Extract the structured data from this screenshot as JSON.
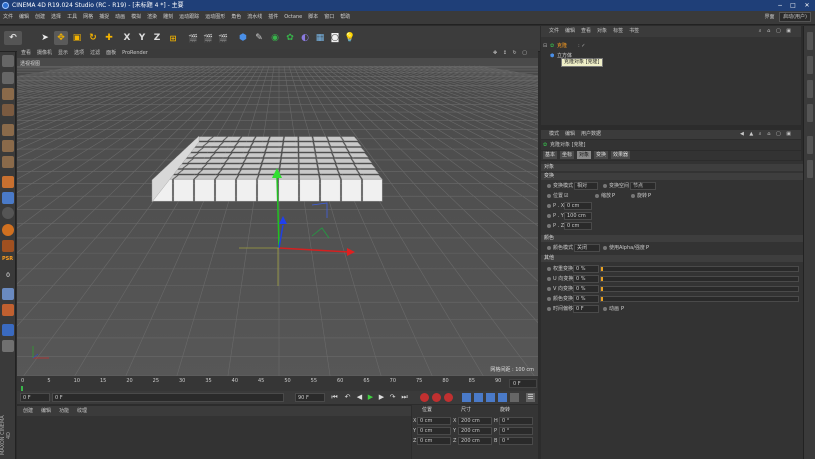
{
  "window": {
    "title": "CINEMA 4D R19.024 Studio (RC - R19) - [未标题 4 *] - 主要",
    "minimize": "−",
    "maximize": "□",
    "close": "✕"
  },
  "menubar": {
    "items": [
      "文件",
      "编辑",
      "创建",
      "选择",
      "工具",
      "网格",
      "捕捉",
      "动画",
      "模拟",
      "渲染",
      "雕刻",
      "运动跟踪",
      "运动图形",
      "角色",
      "流水线",
      "插件",
      "Octane",
      "脚本",
      "窗口",
      "帮助"
    ],
    "layout_label": "界面",
    "layout_value": "启动(用户)"
  },
  "toolbar": {
    "undo_icon": "undo-icon",
    "axis_x": "X",
    "axis_y": "Y",
    "axis_z": "Z"
  },
  "viewport": {
    "menu": [
      "查看",
      "摄像机",
      "显示",
      "选项",
      "过滤",
      "面板",
      "ProRender"
    ],
    "camera_label": "透视视图",
    "grid_distance": "网格间距 : 100 cm",
    "cubes": {
      "rows": 8,
      "cols": 11
    }
  },
  "timeline": {
    "ticks": [
      "0",
      "5",
      "10",
      "15",
      "20",
      "25",
      "30",
      "35",
      "40",
      "45",
      "50",
      "55",
      "60",
      "65",
      "70",
      "75",
      "80",
      "85",
      "90"
    ],
    "current_frame": "0 F"
  },
  "transport": {
    "start": "0 F",
    "current": "0 F",
    "end": "90 F",
    "max": "90 F"
  },
  "materials": {
    "menu": [
      "创建",
      "编辑",
      "功能",
      "纹理"
    ]
  },
  "coordinates": {
    "headers": [
      "位置",
      "尺寸",
      "旋转"
    ],
    "rows": [
      {
        "axis": "X",
        "pos": "0 cm",
        "size_axis": "X",
        "size": "200 cm",
        "rot_axis": "H",
        "rot": "0 °"
      },
      {
        "axis": "Y",
        "pos": "0 cm",
        "size_axis": "Y",
        "size": "200 cm",
        "rot_axis": "P",
        "rot": "0 °"
      },
      {
        "axis": "Z",
        "pos": "0 cm",
        "size_axis": "Z",
        "size": "200 cm",
        "rot_axis": "B",
        "rot": "0 °"
      }
    ]
  },
  "object_manager": {
    "tabs": [
      "文件",
      "编辑",
      "查看",
      "对象",
      "标签",
      "书签"
    ],
    "objects": [
      {
        "name": "克隆"
      },
      {
        "name": "立方体"
      }
    ],
    "tooltip": "克隆对象 [克隆]"
  },
  "attribute_manager": {
    "menu": [
      "模式",
      "编辑",
      "用户数据"
    ],
    "title": "克隆对象 [克隆]",
    "tabs": [
      "基本",
      "坐标",
      "对象",
      "变换",
      "效果器"
    ],
    "active_tab": "对象",
    "section_object": "对象",
    "section_transform": "变换",
    "section_color": "颜色",
    "section_other": "其他",
    "transform": {
      "mode_label": "变换模式",
      "mode_value": "相对",
      "space_label": "变换空间",
      "space_value": "节点",
      "position_label": "位置",
      "scale_label": "缩放",
      "rotation_label": "旋转",
      "scale_flag": "P",
      "rotation_flag": "P",
      "p_x_label": "P . X",
      "p_x": "0 cm",
      "p_y_label": "P . Y",
      "p_y": "100 cm",
      "p_z_label": "P . Z",
      "p_z": "0 cm"
    },
    "color": {
      "mode_label": "颜色模式",
      "mode_value": "关闭",
      "alpha_label": "使用Alpha/强度",
      "alpha_flag": "P"
    },
    "other": {
      "offset_label": "权重变换",
      "offset_value": "0 %",
      "u_label": "U 向变换",
      "u_value": "0 %",
      "v_label": "V 向变换",
      "v_value": "0 %",
      "color_label": "颜色变换",
      "color_value": "0 %",
      "time_label": "时间偏移",
      "time_value": "0 F",
      "anim_label": "动画",
      "anim_flag": "P"
    }
  }
}
